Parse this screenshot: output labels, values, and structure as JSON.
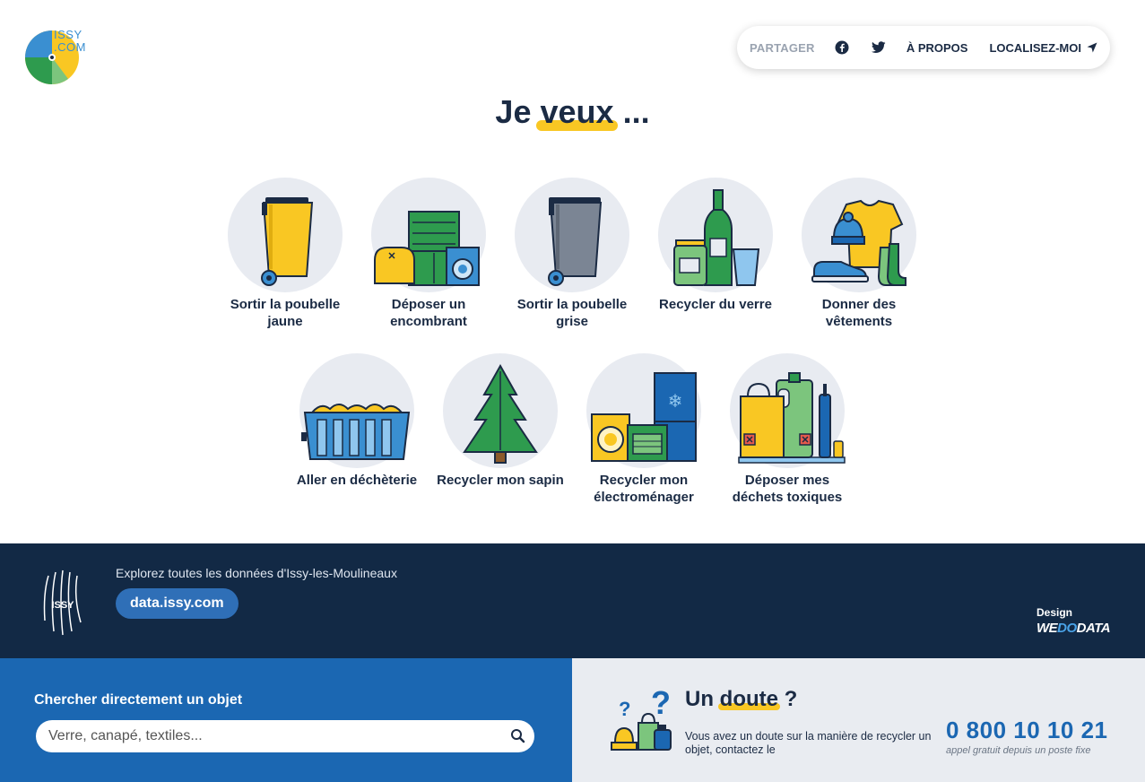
{
  "header": {
    "logo_text_line1": "ISSY",
    "logo_text_line2": ".COM",
    "share_label": "PARTAGER",
    "facebook_icon": "facebook-icon",
    "twitter_icon": "twitter-icon",
    "about_label": "À PROPOS",
    "locate_label": "LOCALISEZ-MOI",
    "locate_icon": "location-arrow-icon"
  },
  "main": {
    "title_prefix": "Je",
    "title_highlight": "veux",
    "title_suffix": "...",
    "tiles": [
      {
        "label": "Sortir la poubelle jaune",
        "icon": "yellow-bin-icon"
      },
      {
        "label": "Déposer un encombrant",
        "icon": "bulky-items-icon"
      },
      {
        "label": "Sortir la poubelle grise",
        "icon": "grey-bin-icon"
      },
      {
        "label": "Recycler du verre",
        "icon": "glass-bottles-icon"
      },
      {
        "label": "Donner des vêtements",
        "icon": "clothes-icon"
      },
      {
        "label": "Aller en déchèterie",
        "icon": "skip-container-icon"
      },
      {
        "label": "Recycler mon sapin",
        "icon": "christmas-tree-icon"
      },
      {
        "label": "Recycler mon électroménager",
        "icon": "appliances-icon"
      },
      {
        "label": "Déposer mes déchets toxiques",
        "icon": "toxic-waste-icon"
      }
    ]
  },
  "band": {
    "explore_text": "Explorez toutes les données d'Issy-les-Moulineaux",
    "data_button": "data.issy.com",
    "issy_logo_text": "ISSY",
    "design_label": "Design",
    "design_brand_we": "WE",
    "design_brand_do": "DO",
    "design_brand_data": "DATA"
  },
  "footer": {
    "search_title": "Chercher directement un objet",
    "search_placeholder": "Verre, canapé, textiles...",
    "search_icon": "search-icon",
    "doubt_prefix": "Un",
    "doubt_highlight": "doute",
    "doubt_suffix": "?",
    "doubt_text": "Vous avez un doute sur la manière de recycler un objet, contactez le",
    "phone": "0 800 10 10 21",
    "phone_note": "appel gratuit depuis un poste fixe"
  },
  "colors": {
    "navy": "#1b2b44",
    "yellow": "#f9c723",
    "blue": "#1b67b2",
    "green": "#2e9b4e",
    "grey_bin": "#7b8594"
  }
}
